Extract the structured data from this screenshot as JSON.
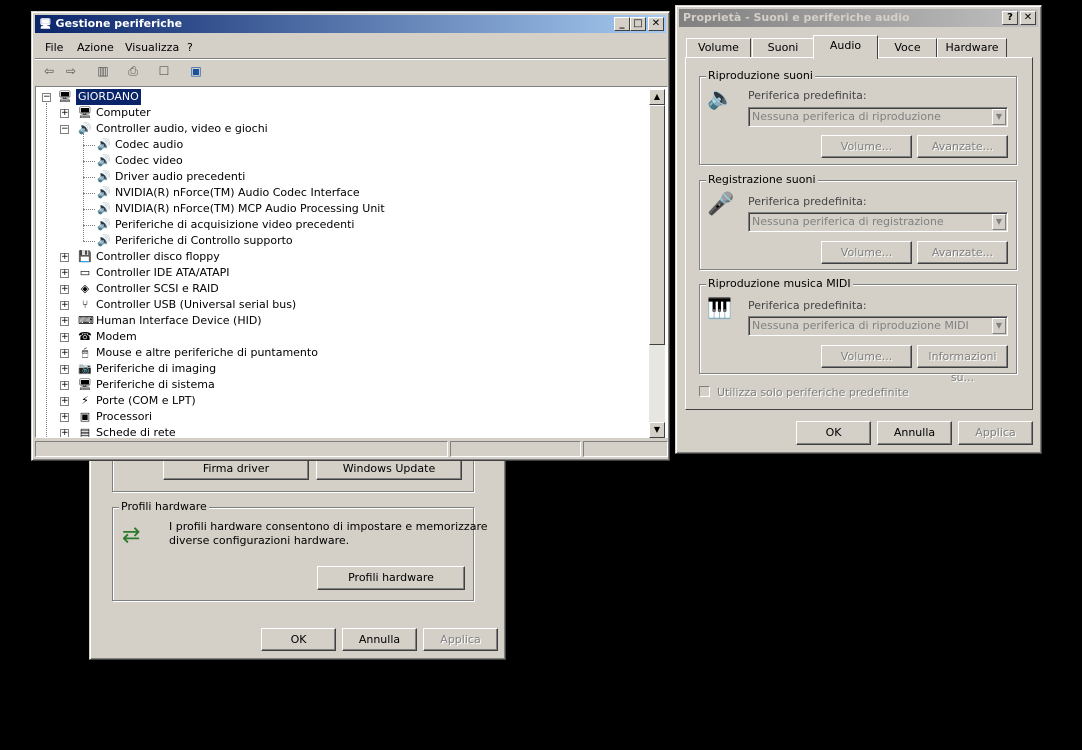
{
  "system_window": {
    "signing_button": "Firma driver",
    "update_button": "Windows Update",
    "profiles_group": "Profili hardware",
    "profiles_text1": "I profili hardware consentono di impostare e memorizzare",
    "profiles_text2": "diverse configurazioni hardware.",
    "profiles_button": "Profili hardware",
    "ok": "OK",
    "cancel": "Annulla",
    "apply": "Applica"
  },
  "device_manager": {
    "title": "Gestione periferiche",
    "menu": [
      "File",
      "Azione",
      "Visualizza",
      "?"
    ],
    "root": "GIORDANO",
    "top_items": [
      {
        "label": "Computer",
        "icon": "computer-icon",
        "glyph": "🖥"
      },
      {
        "label": "Controller audio, video e giochi",
        "icon": "audio-icon",
        "glyph": "🔊",
        "expanded": true
      }
    ],
    "audio_children": [
      "Codec audio",
      "Codec video",
      "Driver audio precedenti",
      "NVIDIA(R) nForce(TM) Audio Codec Interface",
      "NVIDIA(R) nForce(TM) MCP Audio Processing Unit",
      "Periferiche di acquisizione video precedenti",
      "Periferiche di Controllo supporto"
    ],
    "bottom_items": [
      {
        "label": "Controller disco floppy",
        "icon": "floppy-icon",
        "glyph": "💾"
      },
      {
        "label": "Controller IDE ATA/ATAPI",
        "icon": "ide-icon",
        "glyph": "▭"
      },
      {
        "label": "Controller SCSI e RAID",
        "icon": "scsi-icon",
        "glyph": "◈"
      },
      {
        "label": "Controller USB (Universal serial bus)",
        "icon": "usb-icon",
        "glyph": "⑂"
      },
      {
        "label": "Human Interface Device (HID)",
        "icon": "hid-icon",
        "glyph": "⌨"
      },
      {
        "label": "Modem",
        "icon": "modem-icon",
        "glyph": "☎"
      },
      {
        "label": "Mouse e altre periferiche di puntamento",
        "icon": "mouse-icon",
        "glyph": "🖱"
      },
      {
        "label": "Periferiche di imaging",
        "icon": "imaging-icon",
        "glyph": "📷"
      },
      {
        "label": "Periferiche di sistema",
        "icon": "system-icon",
        "glyph": "🖥"
      },
      {
        "label": "Porte (COM e LPT)",
        "icon": "port-icon",
        "glyph": "⚡"
      },
      {
        "label": "Processori",
        "icon": "processor-icon",
        "glyph": "▣"
      },
      {
        "label": "Schede di rete",
        "icon": "network-icon",
        "glyph": "▤"
      }
    ]
  },
  "sound_props": {
    "title": "Proprietà - Suoni e periferiche audio",
    "tabs": [
      "Volume",
      "Suoni",
      "Audio",
      "Voce",
      "Hardware"
    ],
    "selected_tab": "Audio",
    "playback": {
      "group": "Riproduzione suoni",
      "label": "Periferica predefinita:",
      "value": "Nessuna periferica di riproduzione",
      "volume": "Volume...",
      "advanced": "Avanzate..."
    },
    "recording": {
      "group": "Registrazione suoni",
      "label": "Periferica predefinita:",
      "value": "Nessuna periferica di registrazione",
      "volume": "Volume...",
      "advanced": "Avanzate..."
    },
    "midi": {
      "group": "Riproduzione musica MIDI",
      "label": "Periferica predefinita:",
      "value": "Nessuna periferica di riproduzione MIDI",
      "volume": "Volume...",
      "info": "Informazioni su..."
    },
    "checkbox": "Utilizza solo periferiche predefinite",
    "ok": "OK",
    "cancel": "Annulla",
    "apply": "Applica"
  }
}
